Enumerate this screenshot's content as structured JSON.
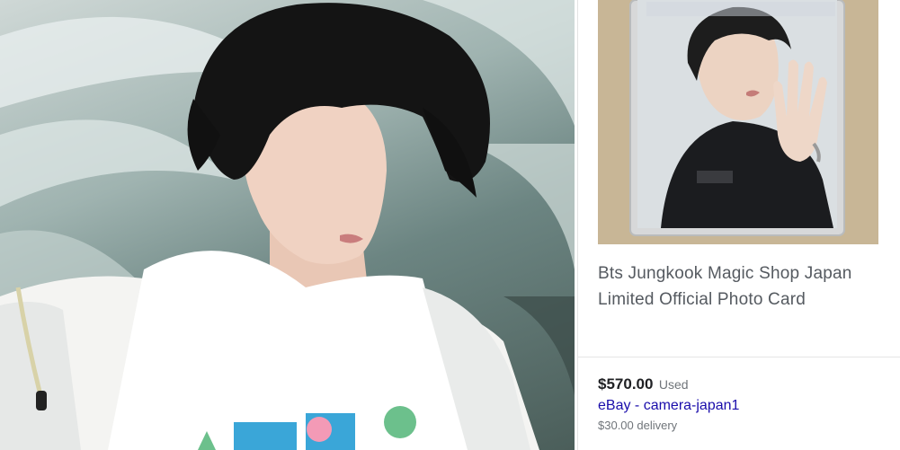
{
  "photo": {
    "subject": "person in white t-shirt and jacket with black hair, looking down, palm leaves background"
  },
  "listing": {
    "title_line1": "Bts Jungkook Magic Shop Japan",
    "title_line2": "Limited Official Photo Card",
    "price": "$570.00",
    "condition": "Used",
    "seller": "eBay - camera-japan1",
    "delivery": "$30.00 delivery"
  },
  "colors": {
    "price": "#202124",
    "link": "#1a0dab",
    "muted": "#70757a",
    "title": "#555a60"
  }
}
